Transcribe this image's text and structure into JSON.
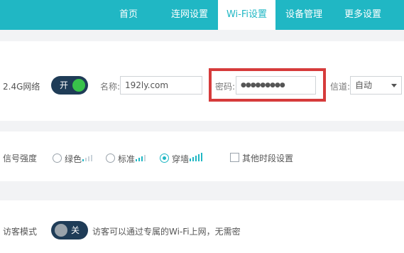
{
  "nav": {
    "items": [
      {
        "label": "首页"
      },
      {
        "label": "连网设置"
      },
      {
        "label": "Wi-Fi设置"
      },
      {
        "label": "设备管理"
      },
      {
        "label": "更多设置"
      }
    ],
    "active": "Wi-Fi设置"
  },
  "wifi24": {
    "label": "2.4G网络",
    "toggle_text": "开",
    "toggle_state": "on",
    "name_label": "名称:",
    "name_value": "192ly.com",
    "password_label": "密码:",
    "password_value": "●●●●●●●●●",
    "channel_label": "信道:",
    "channel_value": "自动",
    "highlight_color": "#d63b3b"
  },
  "signal": {
    "label": "信号强度",
    "options": [
      {
        "label": "绿色",
        "checked": false
      },
      {
        "label": "标准",
        "checked": false
      },
      {
        "label": "穿墙",
        "checked": true
      }
    ],
    "schedule_label": "其他时段设置",
    "schedule_checked": false
  },
  "guest": {
    "label": "访客模式",
    "toggle_text": "关",
    "toggle_state": "off",
    "description": "访客可以通过专属的Wi-Fi上网，无需密"
  },
  "colors": {
    "accent": "#20b7c4",
    "toggle_bg": "#1f3c57",
    "toggle_on": "#38c24a"
  }
}
